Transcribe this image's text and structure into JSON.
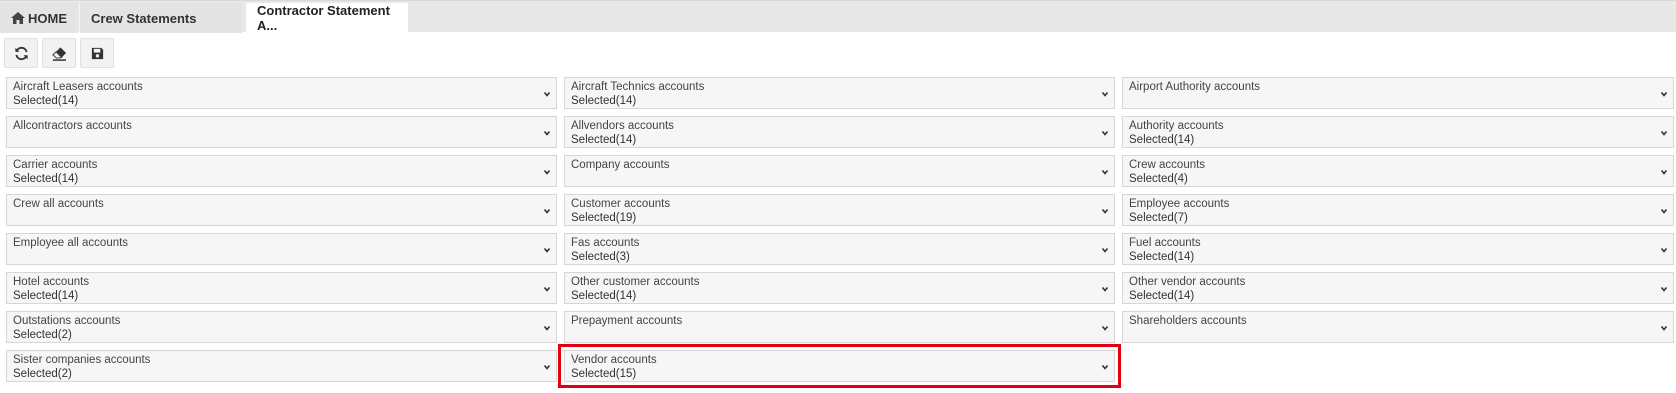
{
  "tabs": {
    "home": "HOME",
    "crew": "Crew Statements",
    "active": "Contractor Statement A..."
  },
  "toolbar": {
    "refresh_icon": "refresh-icon",
    "eraser_icon": "eraser-icon",
    "save_icon": "save-icon"
  },
  "dropdowns": [
    {
      "label": "Aircraft Leasers accounts",
      "value": "Selected(14)"
    },
    {
      "label": "Aircraft Technics accounts",
      "value": "Selected(14)"
    },
    {
      "label": "Airport Authority accounts",
      "value": ""
    },
    {
      "label": "Allcontractors accounts",
      "value": ""
    },
    {
      "label": "Allvendors accounts",
      "value": "Selected(14)"
    },
    {
      "label": "Authority accounts",
      "value": "Selected(14)"
    },
    {
      "label": "Carrier accounts",
      "value": "Selected(14)"
    },
    {
      "label": "Company accounts",
      "value": ""
    },
    {
      "label": "Crew accounts",
      "value": "Selected(4)"
    },
    {
      "label": "Crew all accounts",
      "value": ""
    },
    {
      "label": "Customer accounts",
      "value": "Selected(19)"
    },
    {
      "label": "Employee accounts",
      "value": "Selected(7)"
    },
    {
      "label": "Employee all accounts",
      "value": ""
    },
    {
      "label": "Fas accounts",
      "value": "Selected(3)"
    },
    {
      "label": "Fuel accounts",
      "value": "Selected(14)"
    },
    {
      "label": "Hotel accounts",
      "value": "Selected(14)"
    },
    {
      "label": "Other customer accounts",
      "value": "Selected(14)"
    },
    {
      "label": "Other vendor accounts",
      "value": "Selected(14)"
    },
    {
      "label": "Outstations accounts",
      "value": "Selected(2)"
    },
    {
      "label": "Prepayment accounts",
      "value": ""
    },
    {
      "label": "Shareholders accounts",
      "value": ""
    },
    {
      "label": "Sister companies accounts",
      "value": "Selected(2)"
    },
    {
      "label": "Vendor accounts",
      "value": "Selected(15)"
    }
  ],
  "colors": {
    "highlight": "#e4000f"
  }
}
